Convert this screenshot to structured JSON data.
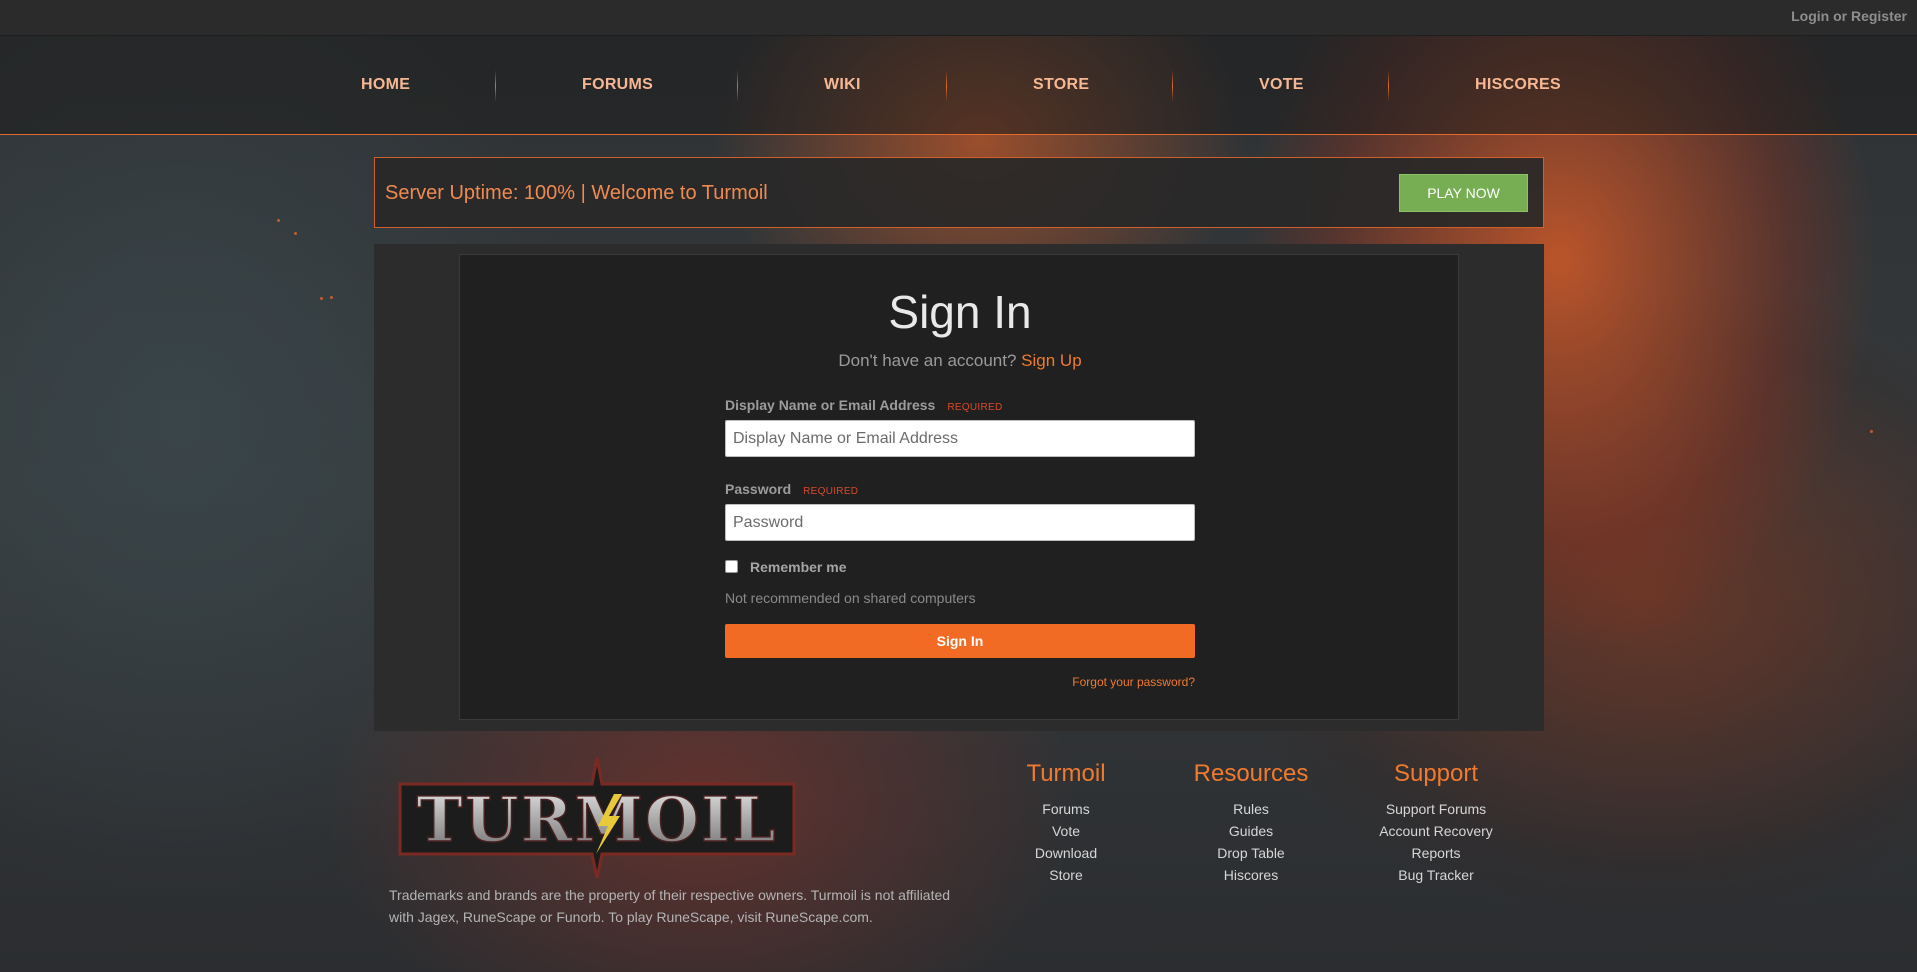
{
  "topbar": {
    "login_label": "Login or Register"
  },
  "nav": {
    "items": [
      {
        "label": "HOME"
      },
      {
        "label": "FORUMS"
      },
      {
        "label": "WIKI"
      },
      {
        "label": "STORE"
      },
      {
        "label": "VOTE"
      },
      {
        "label": "HISCORES"
      }
    ]
  },
  "announcement": {
    "text": "Server Uptime: 100% | Welcome to Turmoil",
    "play_label": "PLAY NOW"
  },
  "signin": {
    "title": "Sign In",
    "no_account_text": "Don't have an account?",
    "signup_label": "Sign Up",
    "username": {
      "label": "Display Name or Email Address",
      "required": "REQUIRED",
      "placeholder": "Display Name or Email Address"
    },
    "password": {
      "label": "Password",
      "required": "REQUIRED",
      "placeholder": "Password"
    },
    "remember_label": "Remember me",
    "remember_hint": "Not recommended on shared computers",
    "submit_label": "Sign In",
    "forgot_label": "Forgot your password?"
  },
  "footer": {
    "logo_text": "TURMOIL",
    "disclaimer": "Trademarks and brands are the property of their respective owners. Turmoil is not affiliated with Jagex, RuneScape or Funorb. To play RuneScape, visit RuneScape.com.",
    "columns": [
      {
        "title": "Turmoil",
        "links": [
          "Forums",
          "Vote",
          "Download",
          "Store"
        ]
      },
      {
        "title": "Resources",
        "links": [
          "Rules",
          "Guides",
          "Drop Table",
          "Hiscores"
        ]
      },
      {
        "title": "Support",
        "links": [
          "Support Forums",
          "Account Recovery",
          "Reports",
          "Bug Tracker"
        ]
      }
    ]
  },
  "colors": {
    "accent": "#f26b25",
    "play_button": "#78ae53",
    "nav_text": "#f7b793",
    "required": "#d84a2a"
  }
}
